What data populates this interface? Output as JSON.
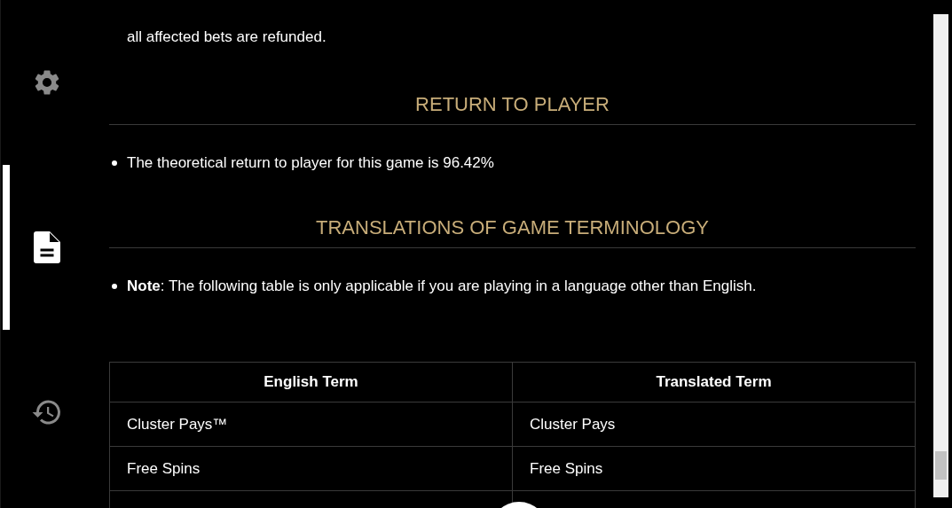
{
  "sidebar": {
    "items": [
      {
        "kind": "settings",
        "selected": false
      },
      {
        "kind": "document",
        "selected": true
      },
      {
        "kind": "history",
        "selected": false
      }
    ]
  },
  "sections": [
    {
      "kind": "text",
      "text": "all affected bets are refunded."
    },
    {
      "kind": "heading",
      "text": "RETURN TO PLAYER"
    },
    {
      "kind": "bullet",
      "text": "The theoretical return to player for this game is 96.42%"
    },
    {
      "kind": "heading",
      "text": "TRANSLATIONS OF GAME TERMINOLOGY"
    },
    {
      "kind": "bullet",
      "text": "**Note**: The following table is only applicable if you are playing in a language other than English."
    }
  ],
  "table": {
    "columns": [
      "English Term",
      "Translated Term"
    ],
    "rows": [
      [
        "Cluster Pays™",
        "Cluster Pays"
      ],
      [
        "Free Spins",
        "Free Spins"
      ]
    ]
  }
}
